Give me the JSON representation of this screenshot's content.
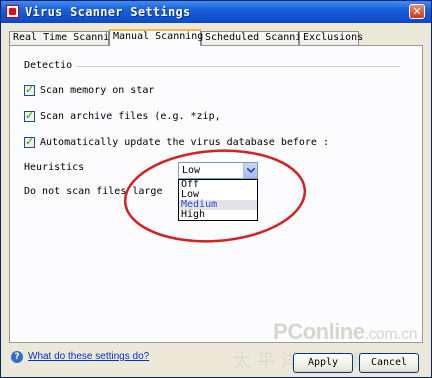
{
  "window": {
    "title": "Virus Scanner Settings",
    "close_glyph": "✕"
  },
  "tabs": [
    {
      "label": "Real Time Scanning"
    },
    {
      "label": "Manual Scanning"
    },
    {
      "label": "Scheduled Scanning"
    },
    {
      "label": "Exclusions"
    }
  ],
  "active_tab": "Manual Scanning",
  "detection": {
    "group_label": "Detectio",
    "options": [
      {
        "label": "Scan memory on star",
        "checked": true
      },
      {
        "label": "Scan archive files (e.g. *zip,",
        "checked": true
      },
      {
        "label": "Automatically update the virus database before :",
        "checked": true
      }
    ]
  },
  "heuristics": {
    "label": "Heuristics",
    "selected": "Low",
    "options": [
      "Off",
      "Low",
      "Medium",
      "High"
    ],
    "highlighted": "Medium"
  },
  "size_limit_label": "Do not scan files large",
  "footer": {
    "help_link": "What do these settings do?",
    "apply_label": "Apply",
    "cancel_label": "Cancel"
  },
  "watermark": {
    "brand": "PConline",
    "domain": ".com.cn",
    "chinese": "太平洋电脑网"
  },
  "colors": {
    "title_bar": "#0a49c9",
    "annotation_ellipse": "#d42020",
    "check_mark": "#21a121",
    "highlight_text": "#1f4cc9"
  }
}
